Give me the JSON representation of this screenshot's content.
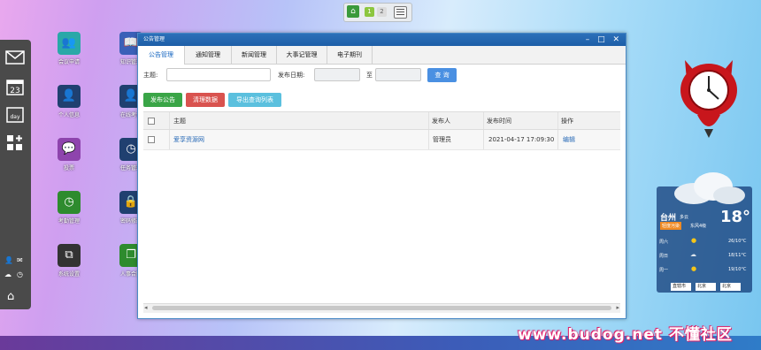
{
  "pager": {
    "home_icon": "house-icon",
    "pages": [
      "1",
      "2"
    ]
  },
  "dock": {
    "icons": [
      "mail-icon",
      "calendar-icon",
      "day-view-icon",
      "add-app-icon",
      "user-icon",
      "mail-small-icon",
      "weather-icon",
      "clock-icon",
      "home-icon"
    ],
    "day_label": "day",
    "calendar_num": "23"
  },
  "desktop": {
    "apps": [
      {
        "label": "会议申请",
        "icon": "meeting-icon",
        "color": "#2aa8a8"
      },
      {
        "label": "知识管理",
        "icon": "knowledge-icon",
        "color": "#3a60b8"
      },
      {
        "label": "个人信息",
        "icon": "person-icon",
        "color": "#204070"
      },
      {
        "label": "在线考试",
        "icon": "exam-icon",
        "color": "#204070"
      },
      {
        "label": "投票",
        "icon": "vote-icon",
        "color": "#8e44ad"
      },
      {
        "label": "任务管理",
        "icon": "task-icon",
        "color": "#204070"
      },
      {
        "label": "考勤管理",
        "icon": "attendance-icon",
        "color": "#2e8b2e"
      },
      {
        "label": "密码修改",
        "icon": "lock-icon",
        "color": "#204070"
      },
      {
        "label": "系统设置",
        "icon": "settings-icon",
        "color": "#333"
      },
      {
        "label": "人事合同",
        "icon": "contract-icon",
        "color": "#2e8b2e"
      }
    ]
  },
  "window": {
    "title": "公告管理",
    "controls": [
      "–",
      "□",
      "✕"
    ],
    "tabs": [
      "公告管理",
      "通知管理",
      "新闻管理",
      "大事记管理",
      "电子期刊"
    ],
    "search": {
      "subject_label": "主题:",
      "date_label": "发布日期:",
      "to_label": "至",
      "query_button": "查 询"
    },
    "actions": {
      "publish": "发布公告",
      "clear": "清理数据",
      "export": "导出查询列表"
    },
    "table": {
      "headers": [
        "主题",
        "发布人",
        "发布时间",
        "操作"
      ],
      "rows": [
        {
          "subject": "爱享资源网",
          "publisher": "管理员",
          "time": "2021-04-17 17:09:30",
          "action": "编辑"
        }
      ]
    }
  },
  "weather": {
    "city": "台州",
    "condition": "多云",
    "aqi": "轻度污染",
    "wind": "东风4级",
    "temp": "18°",
    "forecast": [
      {
        "day": "周六",
        "icon": "sun-icon",
        "range": "26/10°C"
      },
      {
        "day": "周日",
        "icon": "cloud-icon",
        "range": "18/11°C"
      },
      {
        "day": "周一",
        "icon": "sun-icon",
        "range": "19/10°C"
      }
    ],
    "selects": [
      "直辖市",
      "北京",
      "北京"
    ]
  },
  "watermark": "www.budog.net 不懂社区"
}
